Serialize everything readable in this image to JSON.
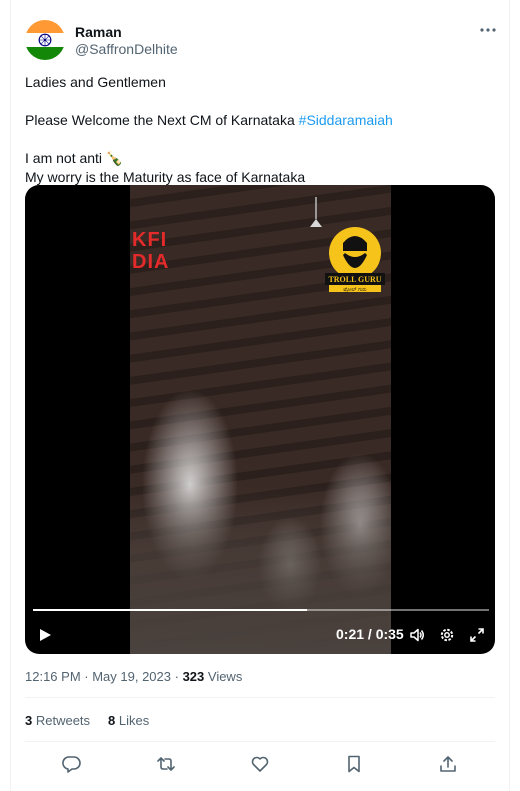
{
  "author": {
    "name": "Raman",
    "handle": "@SaffronDelhite",
    "avatar_icon": "indian-flag-avatar"
  },
  "tweet": {
    "line1": "Ladies and Gentlemen",
    "line2_prefix": "Please Welcome the Next CM of Karnataka ",
    "hashtag": "#Siddaramaiah",
    "line3": "I am not anti 🍾",
    "line4": "My worry is the Maturity as face of Karnataka"
  },
  "video": {
    "overlay_brand": "KFI\nDIA",
    "logo_text_en": "TROLL GURU",
    "logo_text_kn": "ಟ್ರೋಲ್ ಗುರು",
    "current_time": "0:21",
    "duration": "0:35",
    "progress_fraction": 0.6,
    "time_display": "0:21 / 0:35",
    "controls": [
      "play-icon",
      "volume-icon",
      "settings-gear-icon",
      "fullscreen-icon"
    ]
  },
  "meta": {
    "time": "12:16 PM",
    "separator": " · ",
    "date": "May 19, 2023",
    "views_count": "323",
    "views_label": " Views"
  },
  "stats": {
    "retweets_count": "3",
    "retweets_label": " Retweets",
    "likes_count": "8",
    "likes_label": " Likes"
  },
  "actions": [
    "reply-icon",
    "retweet-icon",
    "like-icon",
    "bookmark-icon",
    "share-icon"
  ],
  "colors": {
    "link": "#1d9bf0",
    "secondary_text": "#536471",
    "primary_text": "#0f1419",
    "divider": "#eff3f4"
  }
}
